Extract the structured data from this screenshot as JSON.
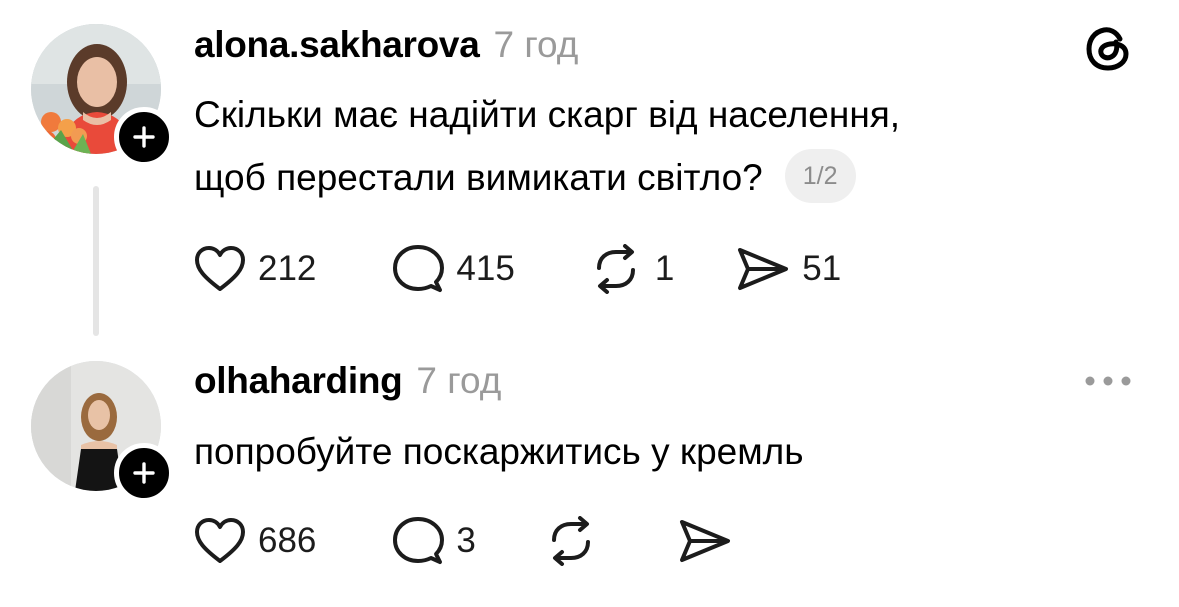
{
  "brand": {
    "icon": "threads-logo-icon"
  },
  "posts": [
    {
      "username": "alona.sakharova",
      "time": "7 год",
      "text_lines": [
        "Скільки має надійти скарг від населення,",
        "щоб перестали вимикати світло?"
      ],
      "page_badge": "1/2",
      "actions": {
        "likes": "212",
        "replies": "415",
        "reposts": "1",
        "shares": "51"
      },
      "avatar_icon": "avatar-photo-woman-flowers",
      "follow_icon": "plus-icon"
    },
    {
      "username": "olhaharding",
      "time": "7 год",
      "text_lines": [
        "попробуйте поскаржитись у кремль"
      ],
      "actions": {
        "likes": "686",
        "replies": "3",
        "reposts": "",
        "shares": ""
      },
      "avatar_icon": "avatar-photo-woman-black-dress",
      "follow_icon": "plus-icon",
      "menu_icon": "more-options-icon"
    }
  ],
  "colors": {
    "text": "#000000",
    "muted": "#9a9a9a",
    "badge_bg": "#efefef",
    "thread_line": "#e5e5e5"
  }
}
